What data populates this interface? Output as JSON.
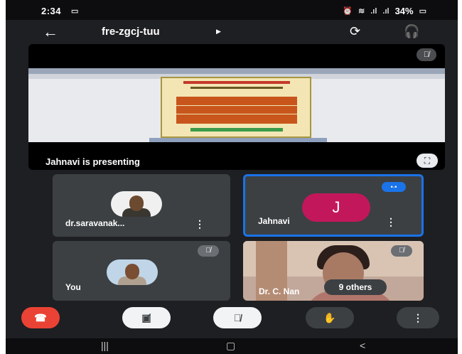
{
  "status_bar": {
    "time": "2:34",
    "cast_icon": "cast-icon",
    "right_icons": [
      "alarm-icon",
      "wifi-icon",
      "signal-icon",
      "signal-icon"
    ],
    "battery": "34%"
  },
  "header": {
    "back_icon": "arrow-left-icon",
    "title": "fre-zgcj-tuu",
    "title_chevron": "caret-right-icon",
    "switch_camera_icon": "switch-camera-icon",
    "audio_icon": "headphones-icon"
  },
  "presentation": {
    "label": "Jahnavi is presenting",
    "mute_icon": "mic-off-icon",
    "fullscreen_icon": "fullscreen-icon"
  },
  "participants": [
    {
      "name": "dr.saravanak...",
      "avatar": "photo",
      "more_icon": "more-vert-icon"
    },
    {
      "name": "Jahnavi",
      "initial": "J",
      "speaking": true,
      "speaking_icon": "audio-level-icon",
      "more_icon": "more-vert-icon"
    },
    {
      "name": "You",
      "avatar": "photo",
      "muted": true,
      "mute_icon": "mic-off-icon"
    },
    {
      "name": "Dr. C. Nan",
      "video": true,
      "muted": true,
      "mute_icon": "mic-off-icon",
      "others_label": "9 others"
    }
  ],
  "controls": {
    "end_call": "call-end-icon",
    "camera": "camera-off-icon",
    "microphone": "mic-off-icon",
    "raise_hand": "raise-hand-icon",
    "more": "more-vert-icon"
  },
  "navigation": {
    "recents": "recents-icon",
    "home": "home-icon",
    "back": "back-icon"
  },
  "colors": {
    "background": "#1e1f22",
    "tile": "#3c4043",
    "end_call": "#ea4335",
    "active_speaker": "#1a73e8",
    "initial_avatar": "#c2185b"
  }
}
